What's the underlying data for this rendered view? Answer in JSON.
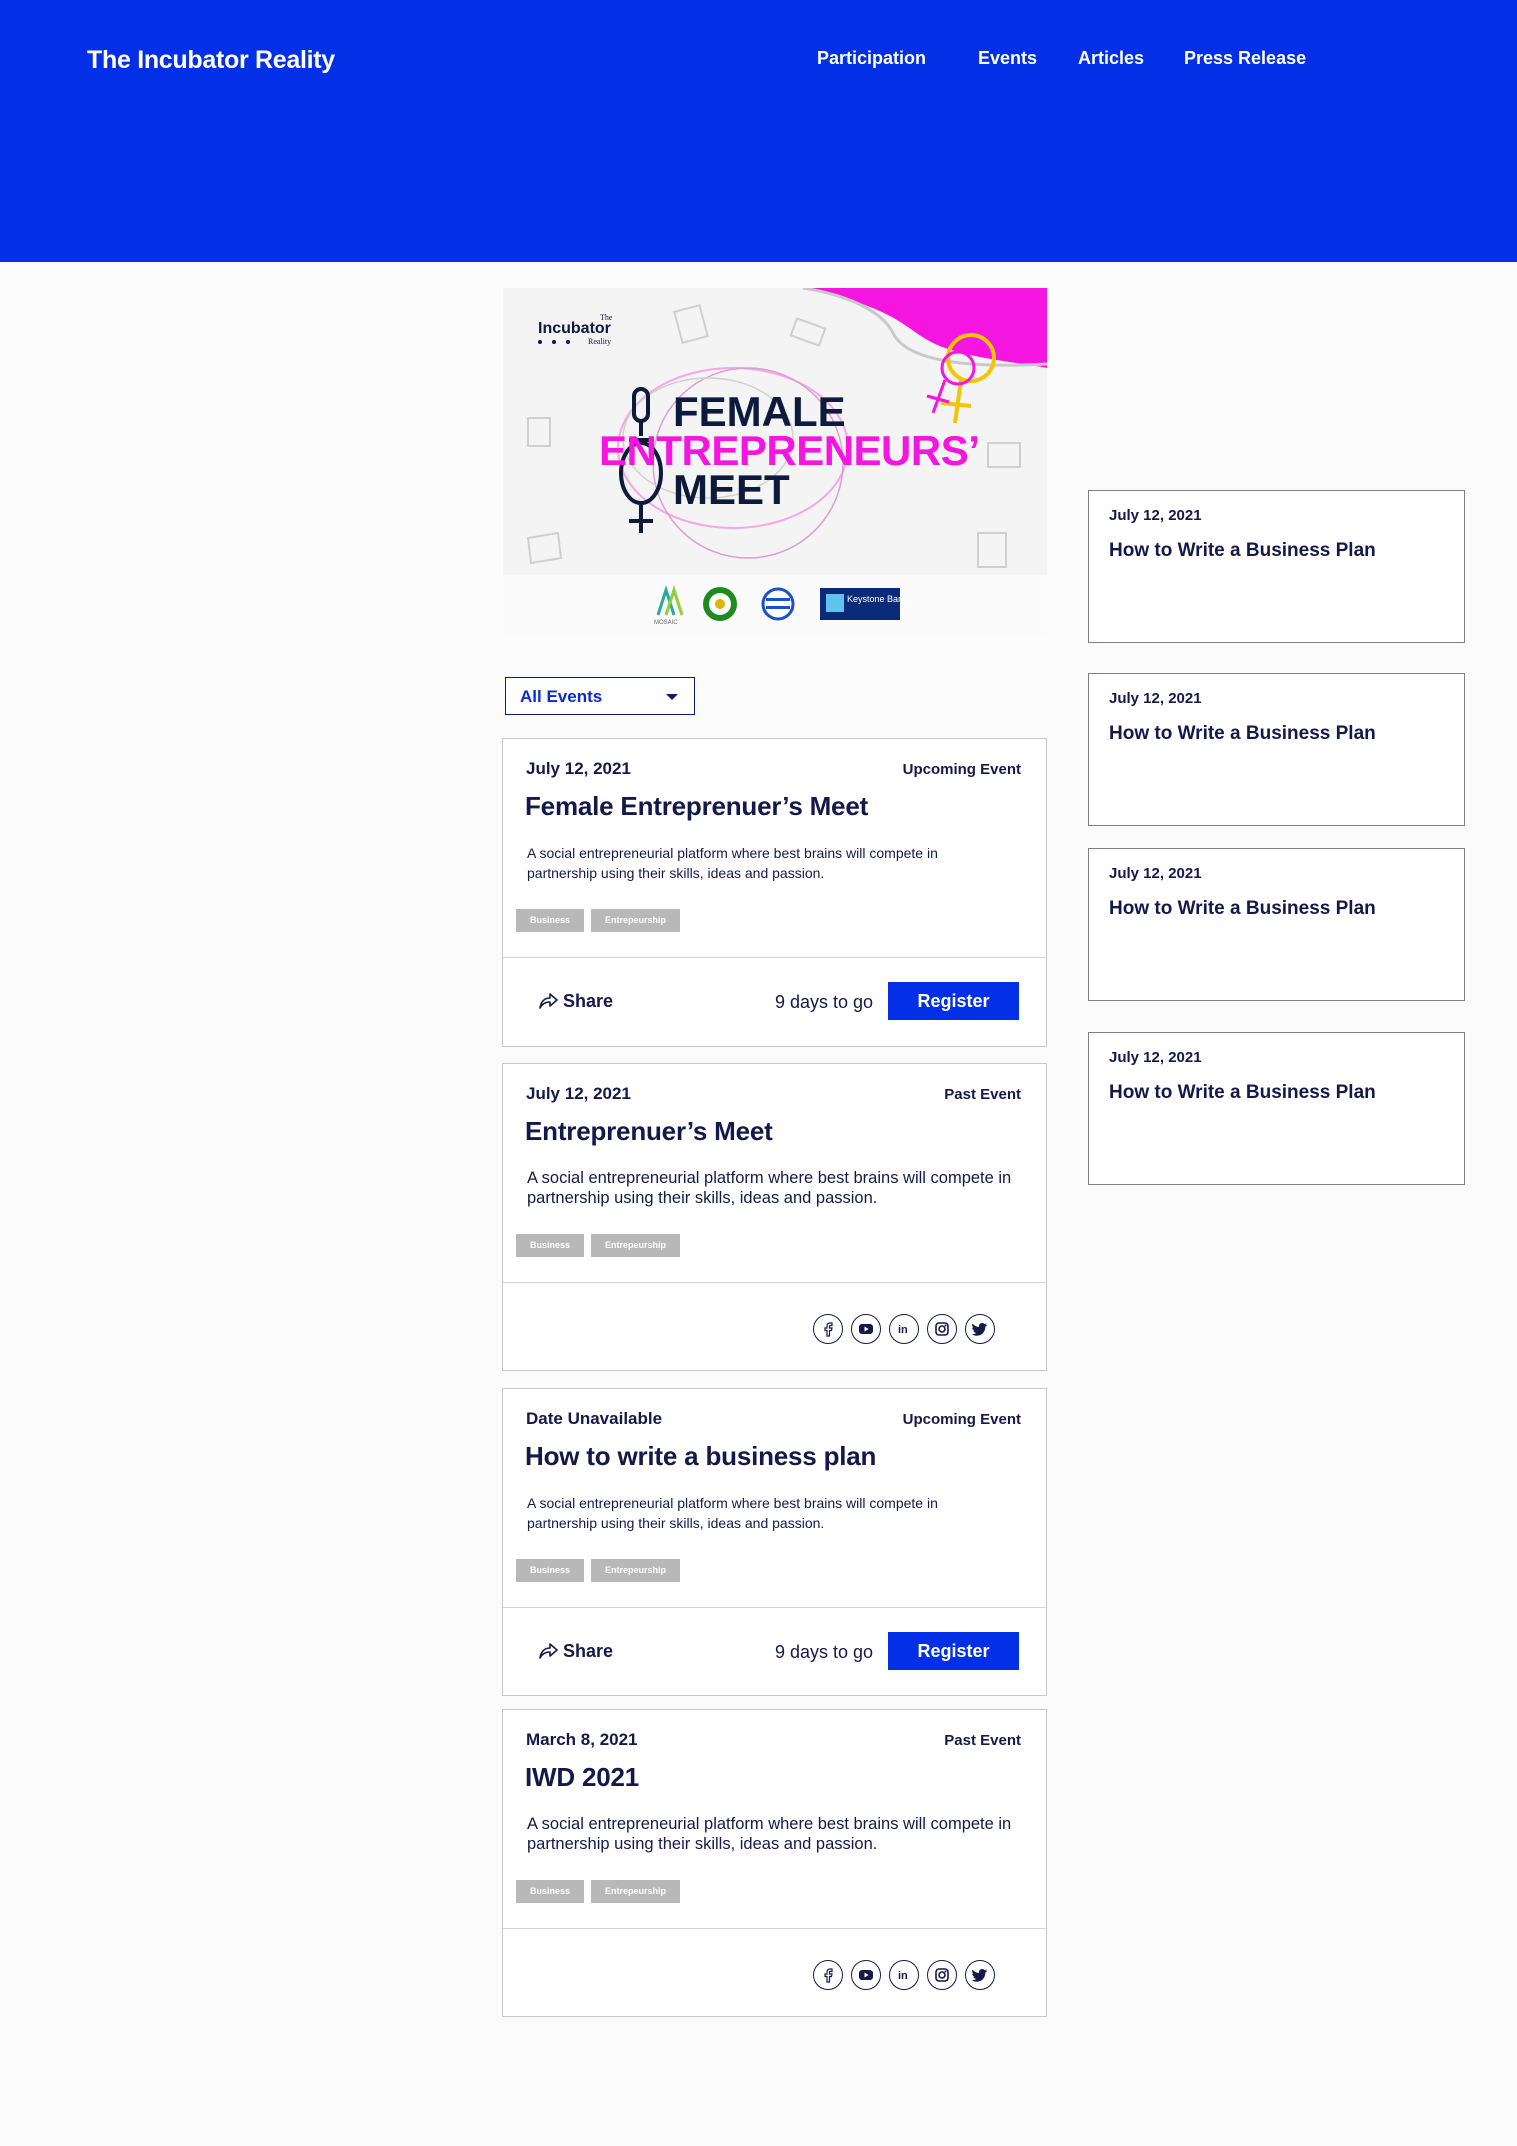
{
  "header": {
    "logo": "The Incubator Reality",
    "nav": [
      "Participation",
      "Events",
      "Articles",
      "Press Release"
    ]
  },
  "hero": {
    "brand_small": "The",
    "brand_main": "Incubator",
    "brand_sub": "Reality",
    "line1": "FEMALE",
    "line2": "ENTREPRENEURS’",
    "line3": "MEET",
    "sponsor_mosaic": "MOSAIC",
    "sponsor_bank": "Keystone Bank",
    "colors": {
      "magenta": "#f416e0",
      "yellow": "#f5c400",
      "navy": "#0e1a3b"
    }
  },
  "filter": {
    "label": "All Events"
  },
  "events": [
    {
      "date": "July 12, 2021",
      "status": "Upcoming Event",
      "title": "Female Entreprenuer’s Meet",
      "description": "A social entrepreneurial platform where best brains will compete in partnership using their skills, ideas and passion.",
      "tags": [
        "Business",
        "Entrepeurship"
      ],
      "share": "Share",
      "countdown": "9 days to go",
      "register": "Register"
    },
    {
      "date": "July 12, 2021",
      "status": "Past Event",
      "title": "Entreprenuer’s Meet",
      "description": "A social entrepreneurial platform where best brains will compete in partnership using their skills, ideas and passion.",
      "tags": [
        "Business",
        "Entrepeurship"
      ],
      "socials": [
        "facebook-icon",
        "youtube-icon",
        "linkedin-icon",
        "instagram-icon",
        "twitter-icon"
      ]
    },
    {
      "date": "Date Unavailable",
      "status": "Upcoming Event",
      "title": "How to write a business plan",
      "description": "A social entrepreneurial platform where best brains will compete in partnership using their skills, ideas and passion.",
      "tags": [
        "Business",
        "Entrepeurship"
      ],
      "share": "Share",
      "countdown": "9 days to go",
      "register": "Register"
    },
    {
      "date": "March 8, 2021",
      "status": "Past Event",
      "title": "IWD 2021",
      "description": "A social entrepreneurial platform where best brains will compete in partnership using their skills, ideas and passion.",
      "tags": [
        "Business",
        "Entrepeurship"
      ],
      "socials": [
        "facebook-icon",
        "youtube-icon",
        "linkedin-icon",
        "instagram-icon",
        "twitter-icon"
      ]
    }
  ],
  "sidebar": [
    {
      "date": "July 12, 2021",
      "title": "How to Write a Business Plan"
    },
    {
      "date": "July 12, 2021",
      "title": "How to Write a Business Plan"
    },
    {
      "date": "July 12, 2021",
      "title": "How to Write a Business Plan"
    },
    {
      "date": "July 12, 2021",
      "title": "How to Write a Business Plan"
    }
  ],
  "colors": {
    "brand_blue": "#0330e6",
    "navy_text": "#14194a",
    "tag_grey": "#b8b8b8"
  }
}
